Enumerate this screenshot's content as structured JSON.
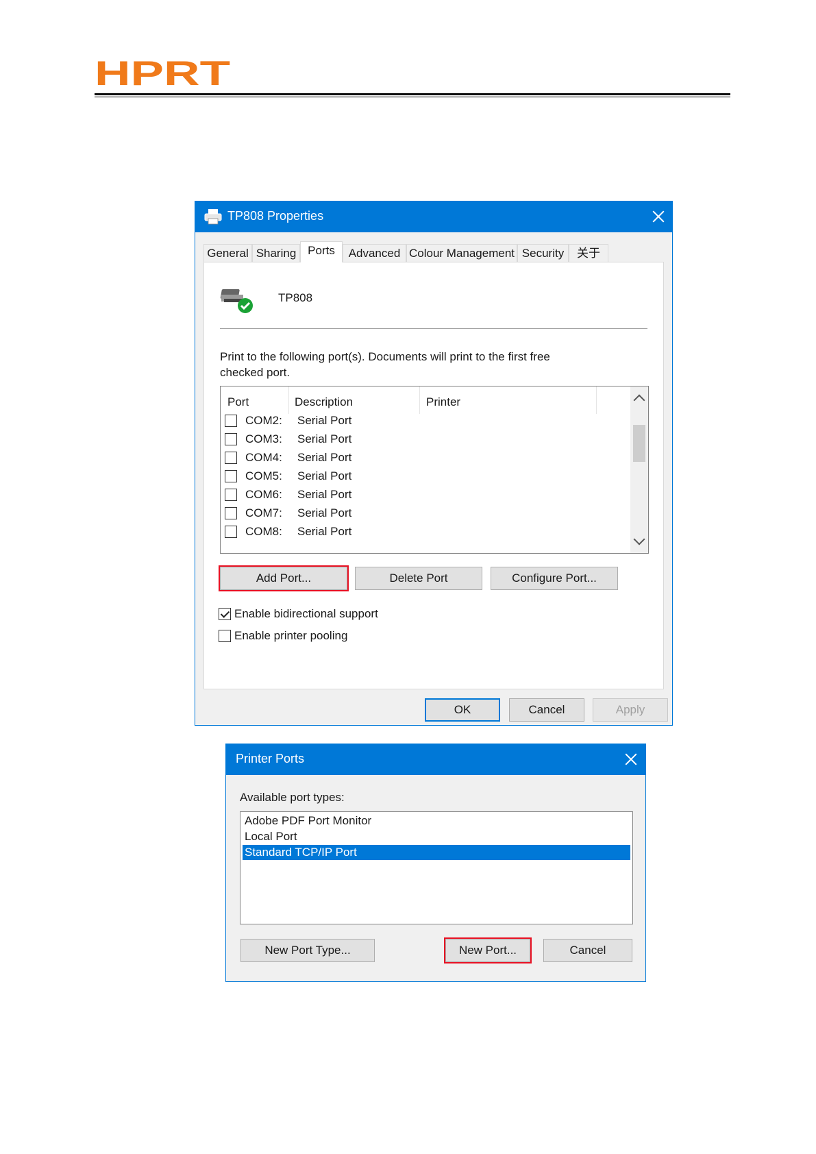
{
  "header": {
    "logo_text": "HPRT",
    "brand_color": "#f07a1a"
  },
  "properties_dialog": {
    "title": "TP808 Properties",
    "tabs": [
      {
        "label": "General"
      },
      {
        "label": "Sharing"
      },
      {
        "label": "Ports"
      },
      {
        "label": "Advanced"
      },
      {
        "label": "Colour Management"
      },
      {
        "label": "Security"
      },
      {
        "label": "关于"
      }
    ],
    "active_tab": "Ports",
    "printer_name": "TP808",
    "instruction_line1": "Print to the following port(s). Documents will print to the first free",
    "instruction_line2": "checked port.",
    "columns": {
      "port": "Port",
      "description": "Description",
      "printer": "Printer"
    },
    "ports": [
      {
        "port": "COM2:",
        "description": "Serial Port",
        "checked": false
      },
      {
        "port": "COM3:",
        "description": "Serial Port",
        "checked": false
      },
      {
        "port": "COM4:",
        "description": "Serial Port",
        "checked": false
      },
      {
        "port": "COM5:",
        "description": "Serial Port",
        "checked": false
      },
      {
        "port": "COM6:",
        "description": "Serial Port",
        "checked": false
      },
      {
        "port": "COM7:",
        "description": "Serial Port",
        "checked": false
      },
      {
        "port": "COM8:",
        "description": "Serial Port",
        "checked": false
      }
    ],
    "add_port": "Add Port...",
    "delete_port": "Delete Port",
    "configure_port": "Configure Port...",
    "bidirectional": {
      "label": "Enable bidirectional support",
      "checked": true
    },
    "pooling": {
      "label": "Enable printer pooling",
      "checked": false
    },
    "ok": "OK",
    "cancel": "Cancel",
    "apply": "Apply",
    "highlight_color": "#e81123",
    "accent_color": "#0078d7"
  },
  "ports_dialog": {
    "title": "Printer Ports",
    "available_label": "Available port types:",
    "port_types": [
      {
        "label": "Adobe PDF Port Monitor",
        "selected": false
      },
      {
        "label": "Local Port",
        "selected": false
      },
      {
        "label": "Standard TCP/IP Port",
        "selected": true
      }
    ],
    "new_port_type": "New Port Type...",
    "new_port": "New Port...",
    "cancel": "Cancel"
  }
}
